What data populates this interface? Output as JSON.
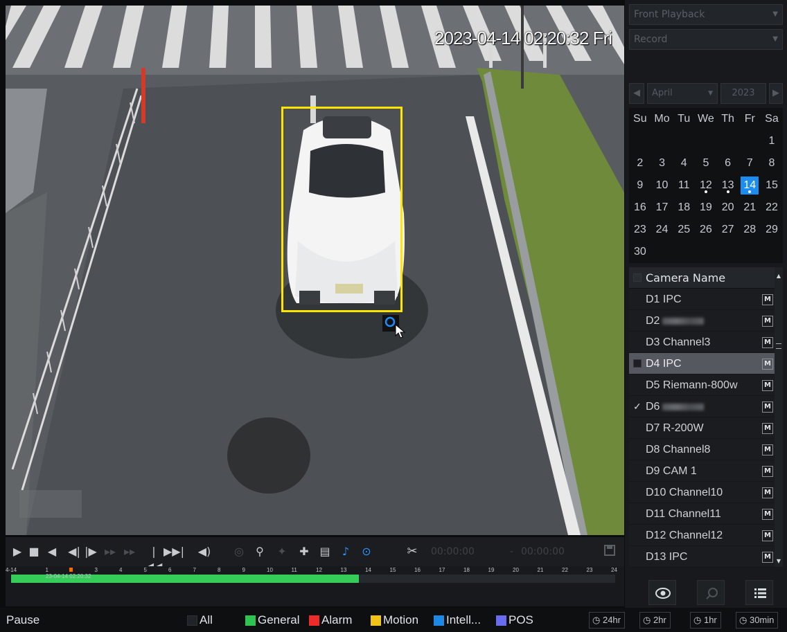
{
  "video": {
    "osd_time": "2023-04-14 02:20:32 Fri"
  },
  "right_panel": {
    "dropdown1": "Front Playback",
    "dropdown2": "Record",
    "calendar_head": {
      "prev": "◀",
      "month": "April",
      "year": "2023",
      "next": "▶"
    },
    "weekdays": [
      "Su",
      "Mo",
      "Tu",
      "We",
      "Th",
      "Fr",
      "Sa"
    ],
    "weeks": [
      [
        "",
        "",
        "",
        "",
        "",
        "",
        "1"
      ],
      [
        "2",
        "3",
        "4",
        "5",
        "6",
        "7",
        "8"
      ],
      [
        "9",
        "10",
        "11",
        "12",
        "13",
        "14",
        "15"
      ],
      [
        "16",
        "17",
        "18",
        "19",
        "20",
        "21",
        "22"
      ],
      [
        "23",
        "24",
        "25",
        "26",
        "27",
        "28",
        "29"
      ],
      [
        "30",
        "",
        "",
        "",
        "",
        "",
        ""
      ]
    ],
    "selected_day": "14",
    "days_with_records": [
      "12",
      "13",
      "14"
    ],
    "camera_list_header": "Camera Name",
    "cameras": [
      {
        "label": "D1 IPC",
        "checked": false,
        "selected": false,
        "blurred": false,
        "badge": "M"
      },
      {
        "label": "D2",
        "checked": false,
        "selected": false,
        "blurred": true,
        "badge": "M"
      },
      {
        "label": "D3 Channel3",
        "checked": false,
        "selected": false,
        "blurred": false,
        "badge": "M"
      },
      {
        "label": "D4 IPC",
        "checked": false,
        "selected": true,
        "blurred": false,
        "badge": "M"
      },
      {
        "label": "D5 Riemann-800w",
        "checked": false,
        "selected": false,
        "blurred": false,
        "badge": "M"
      },
      {
        "label": "D6",
        "checked": true,
        "selected": false,
        "blurred": true,
        "badge": "M"
      },
      {
        "label": "D7 R-200W",
        "checked": false,
        "selected": false,
        "blurred": false,
        "badge": "M"
      },
      {
        "label": "D8 Channel8",
        "checked": false,
        "selected": false,
        "blurred": false,
        "badge": "M"
      },
      {
        "label": "D9 CAM 1",
        "checked": false,
        "selected": false,
        "blurred": false,
        "badge": "M"
      },
      {
        "label": "D10 Channel10",
        "checked": false,
        "selected": false,
        "blurred": false,
        "badge": "M"
      },
      {
        "label": "D11 Channel11",
        "checked": false,
        "selected": false,
        "blurred": false,
        "badge": "M"
      },
      {
        "label": "D12 Channel12",
        "checked": false,
        "selected": false,
        "blurred": false,
        "badge": "M"
      },
      {
        "label": "D13 IPC",
        "checked": false,
        "selected": false,
        "blurred": false,
        "badge": "M"
      }
    ]
  },
  "controls": {
    "time_start": "00:00:00",
    "time_separator": "-",
    "time_end": "00:00:00"
  },
  "timeline": {
    "start_label": "4-14",
    "hour_labels": [
      "1",
      "2",
      "3",
      "4",
      "5",
      "6",
      "7",
      "8",
      "9",
      "10",
      "11",
      "12",
      "13",
      "14",
      "15",
      "16",
      "17",
      "18",
      "19",
      "20",
      "21",
      "22",
      "23",
      "24"
    ],
    "current_label": "23-04-14 02:20:32",
    "recorded_until_hour": 14,
    "record_color": "#35cc5a"
  },
  "status_bar": {
    "state": "Pause",
    "legend": [
      {
        "label": "All",
        "color": "#202327"
      },
      {
        "label": "General",
        "color": "#2fc452"
      },
      {
        "label": "Alarm",
        "color": "#ee2b2b"
      },
      {
        "label": "Motion",
        "color": "#f0c419"
      },
      {
        "label": "Intell...",
        "color": "#1e88e5"
      },
      {
        "label": "POS",
        "color": "#6a6cf0"
      }
    ],
    "zoom_options": [
      "24hr",
      "2hr",
      "1hr",
      "30min"
    ]
  }
}
